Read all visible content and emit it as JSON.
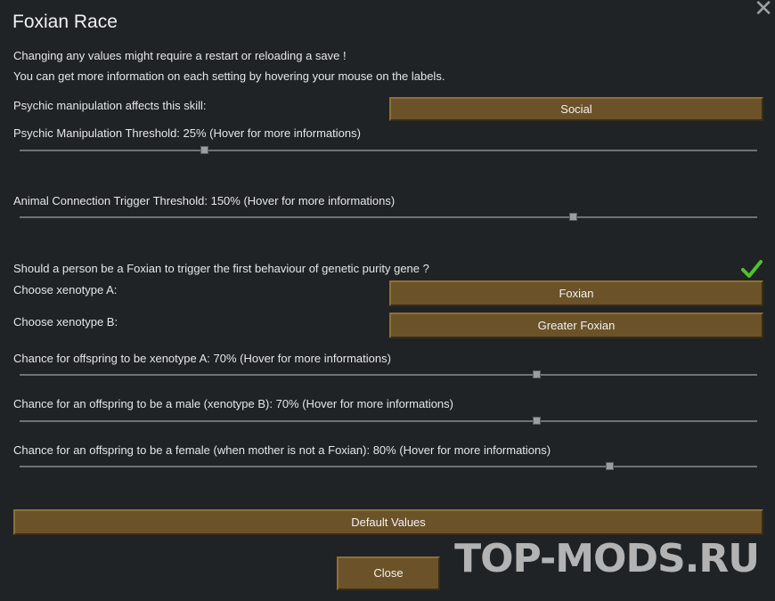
{
  "window": {
    "title": "Foxian Race"
  },
  "info": {
    "line1": "Changing any values might require a restart or reloading a save !",
    "line2": "You can get more information on each setting by hovering your mouse on the labels."
  },
  "psychic_skill": {
    "label": "Psychic manipulation affects this skill:",
    "value": "Social"
  },
  "psychic_threshold": {
    "label": "Psychic Manipulation Threshold: 25% (Hover for more informations)",
    "level": 0.25
  },
  "animal_threshold": {
    "label": "Animal Connection Trigger Threshold: 150% (Hover for more informations)",
    "level": 0.75
  },
  "genetic_purity": {
    "label": "Should a person be a Foxian to trigger the first behaviour of genetic purity gene ?",
    "checked": true
  },
  "xenotype_a": {
    "label": "Choose xenotype A:",
    "value": "Foxian"
  },
  "xenotype_b": {
    "label": "Choose xenotype B:",
    "value": "Greater Foxian"
  },
  "offspring_a": {
    "label": "Chance for offspring to be xenotype A: 70% (Hover for more informations)",
    "level": 0.7
  },
  "offspring_male": {
    "label": "Chance for an offspring to be a male (xenotype B): 70% (Hover for more informations)",
    "level": 0.7
  },
  "offspring_female": {
    "label": "Chance for an offspring to be a female (when mother is not a Foxian): 80% (Hover for more informations)",
    "level": 0.8
  },
  "buttons": {
    "default_values": "Default Values",
    "close": "Close"
  },
  "watermark": "TOP-MODS.RU",
  "colors": {
    "button": "#6b5228",
    "check": "#4cc52a",
    "background": "#1f2326"
  }
}
